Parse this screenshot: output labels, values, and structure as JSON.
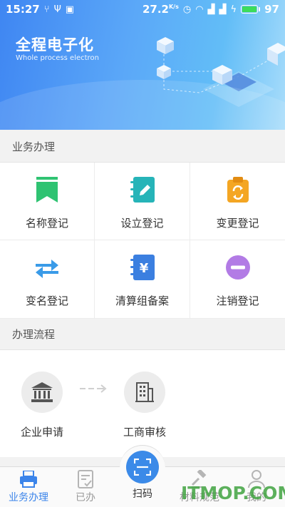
{
  "status_bar": {
    "time": "15:27",
    "speed": "27.2",
    "speed_unit": "K/s",
    "battery_level": "97",
    "battery_fraction": 0.97,
    "icons": [
      "usb-icon",
      "image-icon",
      "alarm-icon",
      "wifi-icon",
      "signal-icon",
      "charging-icon"
    ]
  },
  "banner": {
    "title": "全程电子化",
    "subtitle": "Whole process electron"
  },
  "services": {
    "header": "业务办理",
    "items": [
      {
        "label": "名称登记",
        "icon": "bookmark-icon",
        "color": "#2fc372"
      },
      {
        "label": "设立登记",
        "icon": "notebook-edit-icon",
        "color": "#26b4b8"
      },
      {
        "label": "变更登记",
        "icon": "clipboard-refresh-icon",
        "color": "#f4a623"
      },
      {
        "label": "变名登记",
        "icon": "swap-arrows-icon",
        "color": "#3a9be8"
      },
      {
        "label": "清算组备案",
        "icon": "yen-notebook-icon",
        "color": "#3b7fe0"
      },
      {
        "label": "注销登记",
        "icon": "minus-circle-icon",
        "color": "#b27be5"
      }
    ]
  },
  "process": {
    "header": "办理流程",
    "steps": [
      {
        "label": "企业申请",
        "icon": "bank-building-icon"
      },
      {
        "label": "工商审核",
        "icon": "office-building-icon"
      }
    ]
  },
  "tabbar": {
    "tabs": [
      {
        "label": "业务办理",
        "icon": "printer-icon",
        "active": true
      },
      {
        "label": "已办",
        "icon": "checked-document-icon",
        "active": false
      },
      {
        "label": "扫码",
        "icon": "scan-icon",
        "active": false
      },
      {
        "label": "材料规范",
        "icon": "gavel-icon",
        "active": false
      },
      {
        "label": "我的",
        "icon": "person-icon",
        "active": false
      }
    ],
    "accent": "#3b84ea"
  },
  "watermark": {
    "text": "ITMOP.COM"
  }
}
